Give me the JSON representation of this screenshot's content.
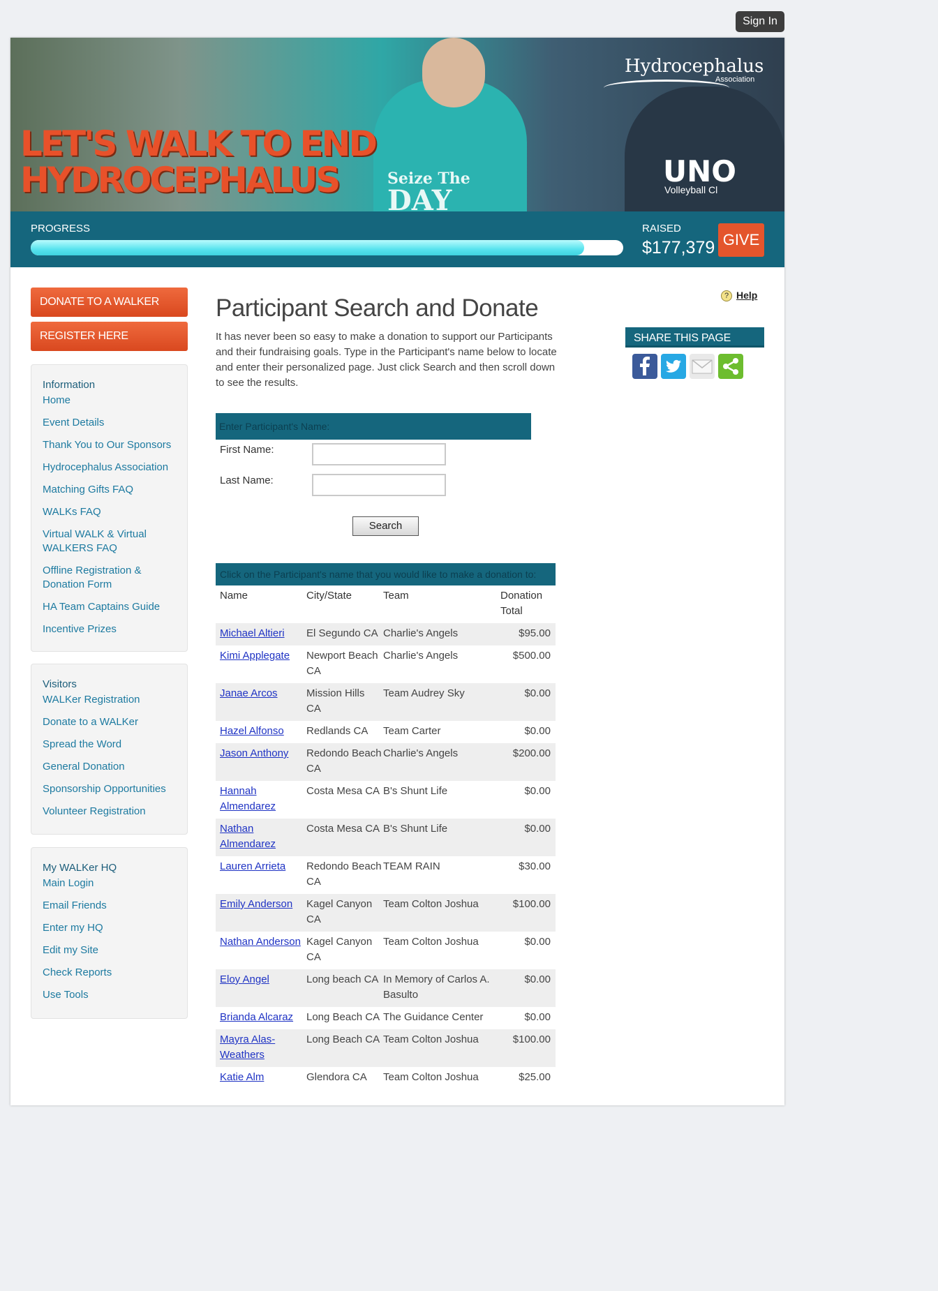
{
  "header": {
    "sign_in": "Sign In"
  },
  "banner": {
    "headline_line1": "LET'S WALK TO END",
    "headline_line2": "HYDROCEPHALUS",
    "brand": "Hydrocephalus",
    "brand_sub": "Association",
    "shirt_text_1": "Seize The",
    "shirt_text_2": "DAY",
    "shirt_text_3": "UNO",
    "shirt_text_4": "Volleyball Cl"
  },
  "progress": {
    "label": "PROGRESS",
    "fill_fraction": 0.934,
    "raised_label": "RAISED",
    "raised_amount": "$177,379",
    "give": "GIVE"
  },
  "sidebar": {
    "donate_button": "DONATE TO A WALKER",
    "register_button": "REGISTER HERE",
    "info": {
      "title": "Information",
      "links": [
        "Home",
        "Event Details",
        "Thank You to Our Sponsors",
        "Hydrocephalus Association",
        "Matching Gifts FAQ",
        "WALKs FAQ",
        "Virtual WALK & Virtual WALKERS FAQ",
        "Offline Registration & Donation Form",
        "HA Team Captains Guide",
        "Incentive Prizes"
      ]
    },
    "visitors": {
      "title": "Visitors",
      "links": [
        "WALKer Registration",
        "Donate to a WALKer",
        "Spread the Word",
        "General Donation",
        "Sponsorship Opportunities",
        "Volunteer Registration"
      ]
    },
    "hq": {
      "title": "My WALKer HQ",
      "links": [
        "Main Login",
        "Email Friends",
        "Enter my HQ",
        "Edit my Site",
        "Check Reports",
        "Use Tools"
      ]
    }
  },
  "main": {
    "title": "Participant Search and Donate",
    "intro": "It has never been so easy to make a donation to support our Participants and their fundraising goals. Type in the Participant's name below to locate and enter their personalized page. Just click Search and then scroll down to see the results.",
    "help": "Help"
  },
  "share": {
    "title": "SHARE THIS PAGE"
  },
  "form": {
    "header": "Enter Participant's Name:",
    "first_name_label": "First Name:",
    "last_name_label": "Last Name:",
    "first_name_value": "",
    "last_name_value": "",
    "search_button": "Search"
  },
  "results": {
    "header": "Click on the Participant's name that you would like to make a donation to:",
    "columns": [
      "Name",
      "City/State",
      "Team",
      "Donation Total"
    ],
    "rows": [
      {
        "name": "Michael Altieri",
        "city": "El Segundo CA",
        "team": "Charlie's Angels",
        "total": "$95.00"
      },
      {
        "name": "Kimi Applegate",
        "city": "Newport Beach CA",
        "team": "Charlie's Angels",
        "total": "$500.00"
      },
      {
        "name": "Janae Arcos",
        "city": "Mission Hills CA",
        "team": "Team Audrey Sky",
        "total": "$0.00"
      },
      {
        "name": "Hazel Alfonso",
        "city": "Redlands CA",
        "team": "Team Carter",
        "total": "$0.00"
      },
      {
        "name": "Jason Anthony",
        "city": "Redondo Beach CA",
        "team": "Charlie's Angels",
        "total": "$200.00"
      },
      {
        "name": "Hannah Almendarez",
        "city": "Costa Mesa CA",
        "team": "B's Shunt Life",
        "total": "$0.00"
      },
      {
        "name": "Nathan Almendarez",
        "city": "Costa Mesa CA",
        "team": "B's Shunt Life",
        "total": "$0.00"
      },
      {
        "name": "Lauren Arrieta",
        "city": "Redondo Beach CA",
        "team": "TEAM RAIN",
        "total": "$30.00"
      },
      {
        "name": "Emily Anderson",
        "city": "Kagel Canyon CA",
        "team": "Team Colton Joshua",
        "total": "$100.00"
      },
      {
        "name": "Nathan Anderson",
        "city": "Kagel Canyon CA",
        "team": "Team Colton Joshua",
        "total": "$0.00"
      },
      {
        "name": "Eloy Angel",
        "city": "Long beach CA",
        "team": "In Memory of Carlos A. Basulto",
        "total": "$0.00"
      },
      {
        "name": "Brianda Alcaraz",
        "city": "Long Beach CA",
        "team": "The Guidance Center",
        "total": "$0.00"
      },
      {
        "name": "Mayra Alas-Weathers",
        "city": "Long Beach CA",
        "team": "Team Colton Joshua",
        "total": "$100.00"
      },
      {
        "name": "Katie Alm",
        "city": "Glendora CA",
        "team": "Team Colton Joshua",
        "total": "$25.00"
      }
    ]
  },
  "colors": {
    "primary": "#15667d",
    "accent": "#e4552c",
    "link": "#1f33c4"
  }
}
